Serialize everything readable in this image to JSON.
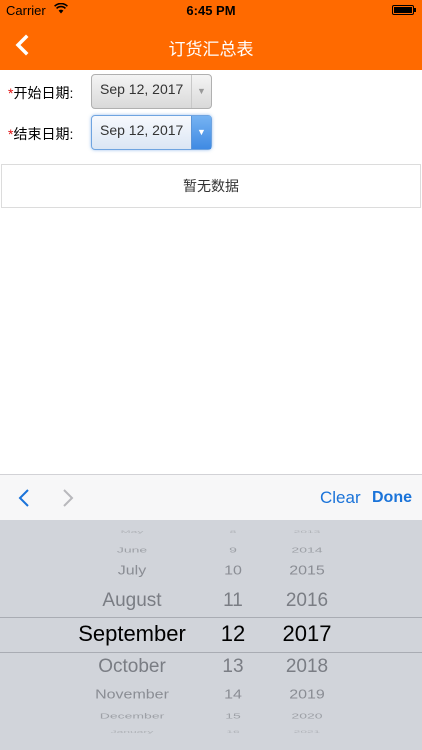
{
  "status_bar": {
    "carrier": "Carrier",
    "time": "6:45 PM"
  },
  "nav": {
    "title": "订货汇总表"
  },
  "form": {
    "required_mark": "*",
    "start_label": "开始日期:",
    "start_value": "Sep 12, 2017",
    "end_label": "结束日期:",
    "end_value": "Sep 12, 2017"
  },
  "empty_message": "暂无数据",
  "toolbar": {
    "clear_label": "Clear",
    "done_label": "Done"
  },
  "picker": {
    "months": [
      "May",
      "June",
      "July",
      "August",
      "September",
      "October",
      "November",
      "December",
      "January"
    ],
    "days": [
      "8",
      "9",
      "10",
      "11",
      "12",
      "13",
      "14",
      "15",
      "16"
    ],
    "years": [
      "2013",
      "2014",
      "2015",
      "2016",
      "2017",
      "2018",
      "2019",
      "2020",
      "2021"
    ],
    "selected_index": 4
  },
  "colors": {
    "accent": "#ff6a00",
    "link": "#1a73d9",
    "required": "#e01010"
  }
}
